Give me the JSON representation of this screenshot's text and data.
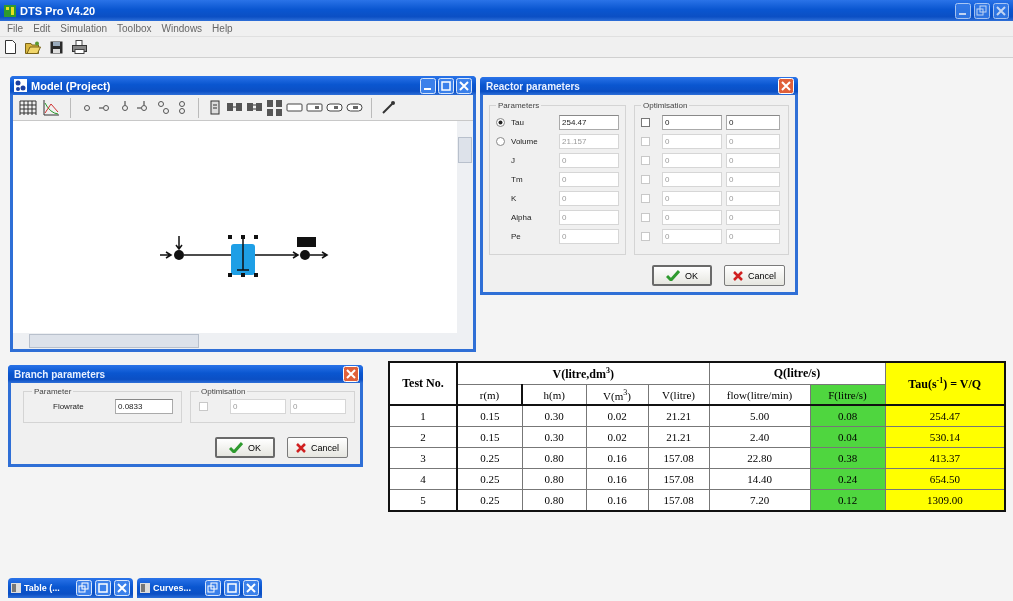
{
  "app": {
    "title": "DTS Pro V4.20"
  },
  "menu": [
    "File",
    "Edit",
    "Simulation",
    "Toolbox",
    "Windows",
    "Help"
  ],
  "model_window": {
    "title": "Model (Project)"
  },
  "reactor_dialog": {
    "title": "Reactor parameters",
    "parameters_label": "Parameters",
    "optimisation_label": "Optimisation",
    "ok": "OK",
    "cancel": "Cancel",
    "rows": [
      {
        "kind": "radio",
        "label": "Tau",
        "selected": true,
        "field": {
          "value": "254.47",
          "disabled": false
        },
        "optimisation": {
          "checked": false,
          "disabled": false,
          "min": "0",
          "max": "0"
        }
      },
      {
        "kind": "radio",
        "label": "Volume",
        "selected": false,
        "field": {
          "value": "21.157",
          "disabled": true
        },
        "optimisation": {
          "checked": false,
          "disabled": true,
          "min": "0",
          "max": "0"
        }
      },
      {
        "kind": "plain",
        "label": "J",
        "field": {
          "value": "0",
          "disabled": true
        },
        "optimisation": {
          "checked": false,
          "disabled": true,
          "min": "0",
          "max": "0"
        }
      },
      {
        "kind": "plain",
        "label": "Tm",
        "field": {
          "value": "0",
          "disabled": true
        },
        "optimisation": {
          "checked": false,
          "disabled": true,
          "min": "0",
          "max": "0"
        }
      },
      {
        "kind": "plain",
        "label": "K",
        "field": {
          "value": "0",
          "disabled": true
        },
        "optimisation": {
          "checked": false,
          "disabled": true,
          "min": "0",
          "max": "0"
        }
      },
      {
        "kind": "plain",
        "label": "Alpha",
        "field": {
          "value": "0",
          "disabled": true
        },
        "optimisation": {
          "checked": false,
          "disabled": true,
          "min": "0",
          "max": "0"
        }
      },
      {
        "kind": "plain",
        "label": "Pe",
        "field": {
          "value": "0",
          "disabled": true
        },
        "optimisation": {
          "checked": false,
          "disabled": true,
          "min": "0",
          "max": "0"
        }
      }
    ]
  },
  "branch_dialog": {
    "title": "Branch parameters",
    "parameters_label": "Parameter",
    "optimisation_label": "Optimisation",
    "ok": "OK",
    "cancel": "Cancel",
    "rows": [
      {
        "kind": "plain",
        "label": "Flowrate",
        "field": {
          "value": "0.0833",
          "disabled": false
        },
        "optimisation": {
          "checked": false,
          "disabled": true,
          "min": "0",
          "max": "0"
        }
      }
    ]
  },
  "table": {
    "header": [
      {
        "kind": "single",
        "label": "Test No."
      },
      {
        "kind": "group",
        "label": "V(litre,dm$^{3}$)",
        "columns": [
          {
            "label": "r(m)"
          },
          {
            "label": "h(m)"
          },
          {
            "label": "V(m$^{3}$)"
          },
          {
            "label": "V(litre)"
          }
        ]
      },
      {
        "kind": "group",
        "label": "Q(litre/s)",
        "columns": [
          {
            "label": "flow(litre/min)"
          },
          {
            "label": "F(litre/s)",
            "color": "#4fd63f"
          }
        ]
      },
      {
        "kind": "single",
        "label": "Tau(s$^{-1}$) = V/Q",
        "color": "#ffff00"
      }
    ],
    "rows": [
      [
        "1",
        "0.15",
        "0.30",
        "0.02",
        "21.21",
        "5.00",
        "0.08",
        "254.47"
      ],
      [
        "2",
        "0.15",
        "0.30",
        "0.02",
        "21.21",
        "2.40",
        "0.04",
        "530.14"
      ],
      [
        "3",
        "0.25",
        "0.80",
        "0.16",
        "157.08",
        "22.80",
        "0.38",
        "413.37"
      ],
      [
        "4",
        "0.25",
        "0.80",
        "0.16",
        "157.08",
        "14.40",
        "0.24",
        "654.50"
      ],
      [
        "5",
        "0.25",
        "0.80",
        "0.16",
        "157.08",
        "7.20",
        "0.12",
        "1309.00"
      ]
    ]
  },
  "minimized_windows": [
    {
      "title": "Table (..."
    },
    {
      "title": "Curves..."
    }
  ]
}
